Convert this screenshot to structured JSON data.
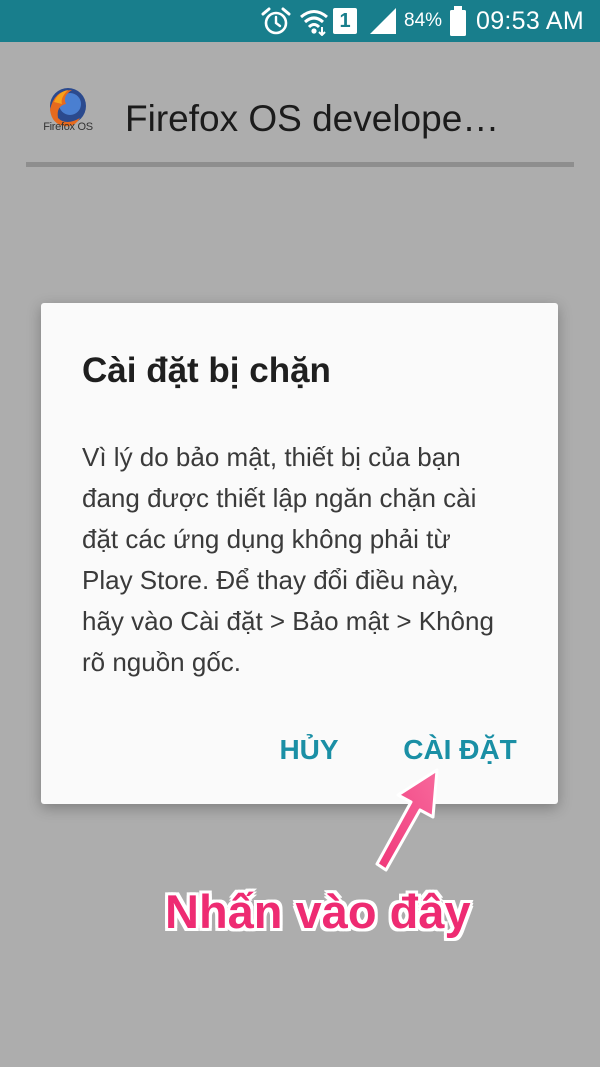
{
  "status_bar": {
    "battery_percent": "84%",
    "time": "09:53 AM",
    "sim_slot": "1",
    "icons": [
      "alarm-icon",
      "wifi-icon",
      "sim-icon",
      "signal-icon",
      "battery-icon"
    ],
    "background_color": "#187e8c"
  },
  "app": {
    "title": "Firefox OS develope…",
    "logo_caption": "Firefox OS",
    "logo_icon": "firefox-logo-icon"
  },
  "dialog": {
    "title": "Cài đặt bị chặn",
    "body_lines": [
      "Vì lý do bảo mật, thiết bị của bạn",
      "đang được thiết lập ngăn chặn cài",
      "đặt các ứng dụng không phải từ",
      "Play Store. Để thay đổi điều này,",
      "hãy vào Cài đặt > Bảo mật > Không",
      "rõ nguồn gốc."
    ],
    "cancel_label": "HỦY",
    "install_label": "CÀI ĐẶT",
    "accent_color": "#1a8fa5"
  },
  "annotation": {
    "text": "Nhấn vào đây",
    "color": "#ee2b72"
  }
}
